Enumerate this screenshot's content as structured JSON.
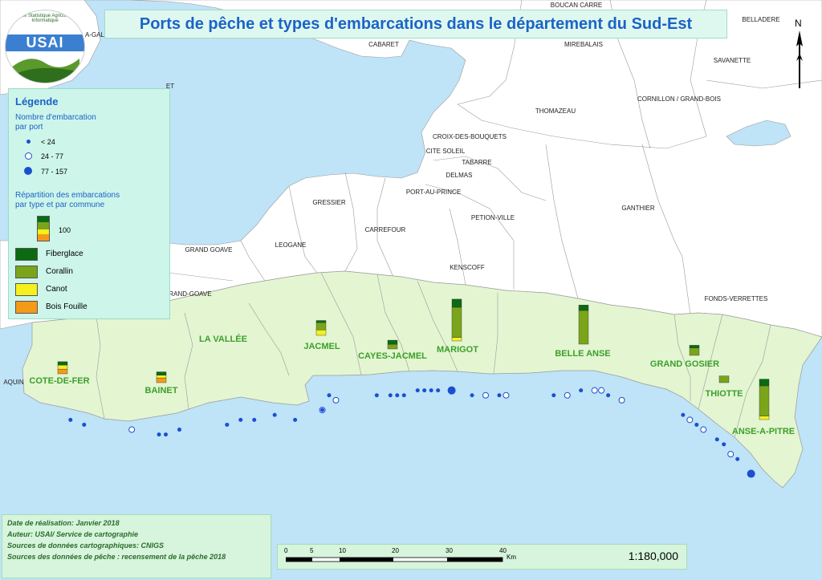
{
  "title": "Ports de pêche et types d'embarcations dans le département du Sud-Est",
  "logo": {
    "acronym": "USAI",
    "arc_text": "Unité Statistique Agricole et Informatique"
  },
  "north_label": "N",
  "legend": {
    "title": "Légende",
    "size_title_1": "Nombre d'embarcation",
    "size_title_2": "par port",
    "size_classes": [
      "< 24",
      "24 - 77",
      "77 - 157"
    ],
    "bars_title_1": "Répartition des embarcations",
    "bars_title_2": "par type et par commune",
    "bar_reference": "100",
    "types": [
      {
        "label": "Fiberglace",
        "color": "#0b6b12"
      },
      {
        "label": "Corallin",
        "color": "#7aa51a"
      },
      {
        "label": "Canot",
        "color": "#f4f11f"
      },
      {
        "label": "Bois Fouille",
        "color": "#f59a18"
      }
    ]
  },
  "place_labels": [
    "BOUCAN CARRE",
    "BELLADERE",
    "CABARET",
    "MIREBALAIS",
    "SAVANETTE",
    "THOMAZEAU",
    "CORNILLON / GRAND-BOIS",
    "CROIX-DES-BOUQUETS",
    "CITE SOLEIL",
    "TABARRE",
    "DELMAS",
    "PORT-AU-PRINCE",
    "GRESSIER",
    "PETION-VILLE",
    "GANTHIER",
    "CARREFOUR",
    "LEOGANE",
    "KENSCOFF",
    "FONDS-VERRETTES",
    "GRAND GOAVE",
    "RAND-GOAVE",
    "AQUIN",
    "A-GAL",
    "ET"
  ],
  "communes": [
    {
      "name": "COTE-DE-FER",
      "bars": [
        5,
        0,
        6,
        7
      ]
    },
    {
      "name": "BAINET",
      "bars": [
        5,
        0,
        4,
        7
      ]
    },
    {
      "name": "LA VALLÉE",
      "bars": null
    },
    {
      "name": "JACMEL",
      "bars": [
        3,
        11,
        8,
        0
      ]
    },
    {
      "name": "CAYES-JACMEL",
      "bars": [
        6,
        7,
        0,
        0
      ]
    },
    {
      "name": "MARIGOT",
      "bars": [
        12,
        45,
        5,
        0
      ]
    },
    {
      "name": "BELLE ANSE",
      "bars": [
        8,
        50,
        0,
        0
      ]
    },
    {
      "name": "GRAND GOSIER",
      "bars": [
        4,
        11,
        0,
        0
      ]
    },
    {
      "name": "THIOTTE",
      "bars": [
        0,
        10,
        0,
        0
      ]
    },
    {
      "name": "ANSE-A-PITRE",
      "bars": [
        10,
        45,
        5,
        0
      ]
    }
  ],
  "ports": [
    {
      "lon": -73.02,
      "lat": 18.18,
      "cls": 0
    },
    {
      "lon": -73.0,
      "lat": 18.17,
      "cls": 0
    },
    {
      "lon": -72.93,
      "lat": 18.16,
      "cls": 1
    },
    {
      "lon": -72.89,
      "lat": 18.15,
      "cls": 0
    },
    {
      "lon": -72.88,
      "lat": 18.15,
      "cls": 0
    },
    {
      "lon": -72.86,
      "lat": 18.16,
      "cls": 0
    },
    {
      "lon": -72.79,
      "lat": 18.17,
      "cls": 0
    },
    {
      "lon": -72.77,
      "lat": 18.18,
      "cls": 0
    },
    {
      "lon": -72.75,
      "lat": 18.18,
      "cls": 0
    },
    {
      "lon": -72.72,
      "lat": 18.19,
      "cls": 0
    },
    {
      "lon": -72.69,
      "lat": 18.18,
      "cls": 0
    },
    {
      "lon": -72.65,
      "lat": 18.2,
      "cls": 1
    },
    {
      "lon": -72.65,
      "lat": 18.2,
      "cls": 0
    },
    {
      "lon": -72.64,
      "lat": 18.23,
      "cls": 0
    },
    {
      "lon": -72.63,
      "lat": 18.22,
      "cls": 1
    },
    {
      "lon": -72.57,
      "lat": 18.23,
      "cls": 0
    },
    {
      "lon": -72.55,
      "lat": 18.23,
      "cls": 0
    },
    {
      "lon": -72.54,
      "lat": 18.23,
      "cls": 0
    },
    {
      "lon": -72.53,
      "lat": 18.23,
      "cls": 0
    },
    {
      "lon": -72.51,
      "lat": 18.24,
      "cls": 0
    },
    {
      "lon": -72.5,
      "lat": 18.24,
      "cls": 0
    },
    {
      "lon": -72.49,
      "lat": 18.24,
      "cls": 0
    },
    {
      "lon": -72.48,
      "lat": 18.24,
      "cls": 0
    },
    {
      "lon": -72.46,
      "lat": 18.24,
      "cls": 2
    },
    {
      "lon": -72.43,
      "lat": 18.23,
      "cls": 0
    },
    {
      "lon": -72.41,
      "lat": 18.23,
      "cls": 1
    },
    {
      "lon": -72.39,
      "lat": 18.23,
      "cls": 0
    },
    {
      "lon": -72.38,
      "lat": 18.23,
      "cls": 1
    },
    {
      "lon": -72.31,
      "lat": 18.23,
      "cls": 0
    },
    {
      "lon": -72.29,
      "lat": 18.23,
      "cls": 1
    },
    {
      "lon": -72.27,
      "lat": 18.24,
      "cls": 0
    },
    {
      "lon": -72.25,
      "lat": 18.24,
      "cls": 1
    },
    {
      "lon": -72.24,
      "lat": 18.24,
      "cls": 1
    },
    {
      "lon": -72.23,
      "lat": 18.23,
      "cls": 0
    },
    {
      "lon": -72.21,
      "lat": 18.22,
      "cls": 1
    },
    {
      "lon": -72.12,
      "lat": 18.19,
      "cls": 0
    },
    {
      "lon": -72.11,
      "lat": 18.18,
      "cls": 1
    },
    {
      "lon": -72.1,
      "lat": 18.17,
      "cls": 0
    },
    {
      "lon": -72.09,
      "lat": 18.16,
      "cls": 1
    },
    {
      "lon": -72.07,
      "lat": 18.14,
      "cls": 0
    },
    {
      "lon": -72.06,
      "lat": 18.13,
      "cls": 0
    },
    {
      "lon": -72.05,
      "lat": 18.11,
      "cls": 1
    },
    {
      "lon": -72.04,
      "lat": 18.1,
      "cls": 0
    },
    {
      "lon": -72.02,
      "lat": 18.07,
      "cls": 2
    }
  ],
  "footer": {
    "line1": "Date de réalisation: Janvier 2018",
    "line2": "Auteur: USAI/ Service de cartographie",
    "line3": "Sources de données cartographiques: CNIGS",
    "line4": "Sources des données de pêche : recensement de la pêche 2018"
  },
  "scale": {
    "ticks": [
      "0",
      "5",
      "10",
      "20",
      "30",
      "40"
    ],
    "unit": "Km",
    "ratio": "1:180,000"
  },
  "colors": {
    "sea": "#bfe3f7",
    "land": "#ffffff",
    "sud_est": "#e4f5d2",
    "border": "#9a9a9a",
    "port": "#1a4fd1"
  }
}
